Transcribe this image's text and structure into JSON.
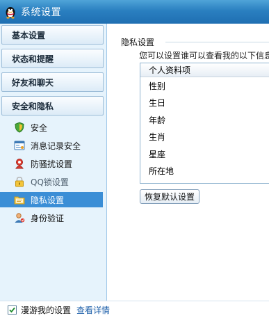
{
  "window": {
    "title": "系统设置"
  },
  "sidebar": {
    "categories": [
      {
        "label": "基本设置"
      },
      {
        "label": "状态和提醒"
      },
      {
        "label": "好友和聊天"
      },
      {
        "label": "安全和隐私"
      }
    ],
    "items": [
      {
        "label": "安全",
        "icon": "shield-icon"
      },
      {
        "label": "消息记录安全",
        "icon": "message-record-icon"
      },
      {
        "label": "防骚扰设置",
        "icon": "anti-harassment-icon"
      },
      {
        "label": "QQ锁设置",
        "icon": "lock-icon"
      },
      {
        "label": "隐私设置",
        "icon": "privacy-folder-icon",
        "selected": true
      },
      {
        "label": "身份验证",
        "icon": "identity-verify-icon"
      }
    ]
  },
  "main": {
    "section_title": "隐私设置",
    "description": "您可以设置谁可以查看我的以下信息",
    "list": {
      "header": "个人资料项",
      "rows": [
        "性别",
        "生日",
        "年龄",
        "生肖",
        "星座",
        "所在地"
      ]
    },
    "restore_button": "恢复默认设置"
  },
  "bottom": {
    "checkbox_label": "漫游我的设置",
    "checkbox_checked": true,
    "link_label": "查看详情"
  },
  "colors": {
    "title_bar": "#2a7fc0",
    "selected_item": "#3b8ed6",
    "link": "#1a5da8"
  }
}
